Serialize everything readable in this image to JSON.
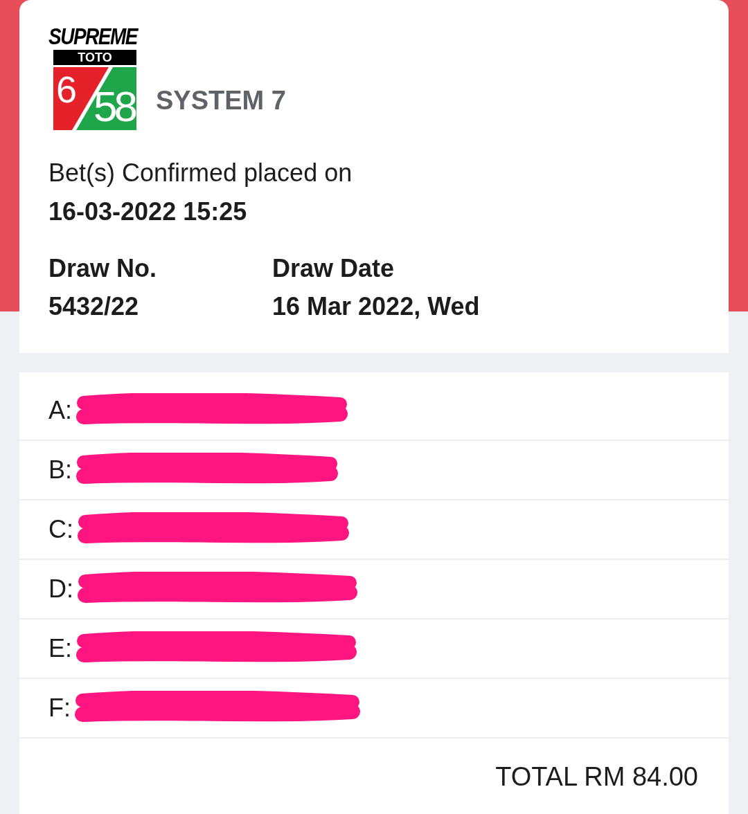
{
  "logo": {
    "wordmark": "SUPREME",
    "banner": "TOTO",
    "left_number": "6",
    "right_number": "58"
  },
  "bet_type": "SYSTEM 7",
  "confirmation": {
    "text": "Bet(s) Confirmed placed on",
    "timestamp": "16-03-2022 15:25"
  },
  "draw": [
    {
      "label": "Draw No.",
      "value": "5432/22"
    },
    {
      "label": "Draw Date",
      "value": "16 Mar 2022, Wed"
    }
  ],
  "bets": [
    {
      "label": "A:",
      "redacted": true
    },
    {
      "label": "B:",
      "redacted": true
    },
    {
      "label": "C:",
      "redacted": true
    },
    {
      "label": "D:",
      "redacted": true
    },
    {
      "label": "E:",
      "redacted": true
    },
    {
      "label": "F:",
      "redacted": true
    }
  ],
  "total": "TOTAL RM 84.00"
}
